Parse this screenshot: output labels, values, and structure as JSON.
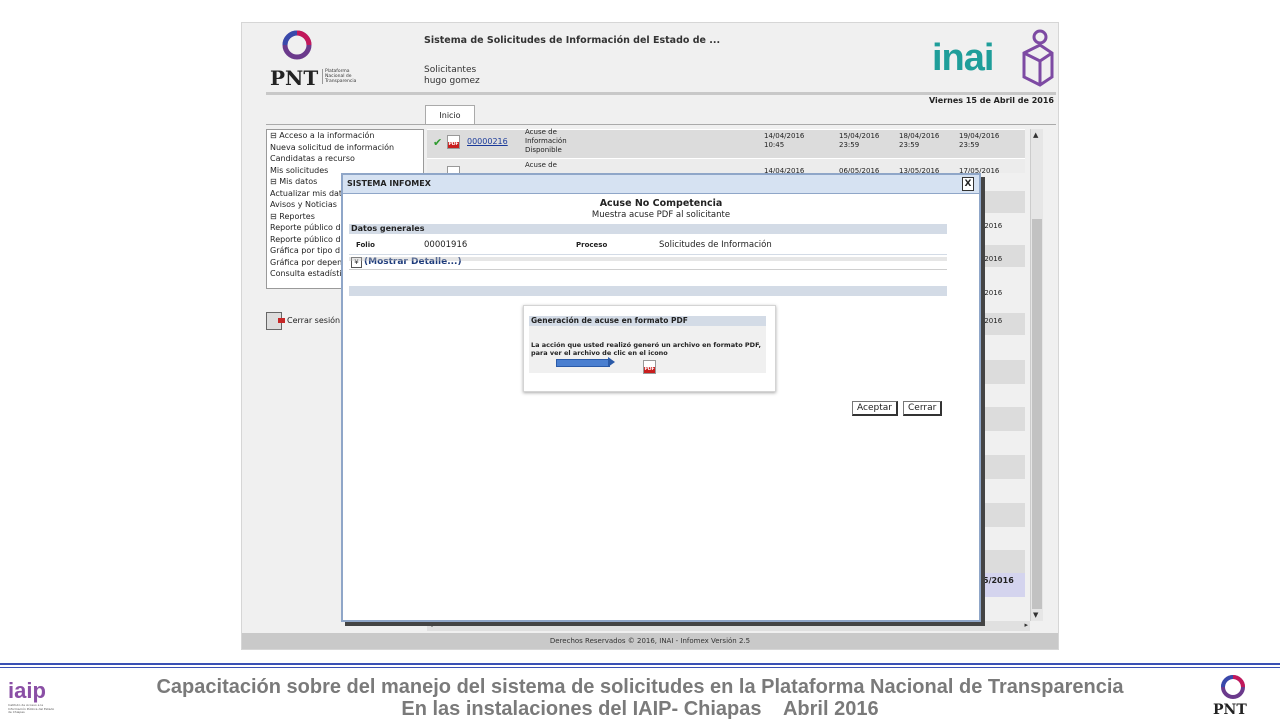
{
  "app": {
    "title": "Sistema de Solicitudes de Información del Estado de ...",
    "user_role": "Solicitantes",
    "user_name": "hugo gomez",
    "date": "Viernes 15 de Abril de 2016",
    "tab": "Inicio",
    "pnt_logo": {
      "word": "PNT",
      "sub": "Plataforma Nacional de Transparencia"
    },
    "inai_logo": "inai"
  },
  "sidebar": {
    "items": [
      "⊟ Acceso a la información",
      "Nueva solicitud de información",
      "Candidatas a recurso",
      "Mis solicitudes",
      "⊟ Mis datos",
      "Actualizar mis datos",
      "Avisos y Noticias",
      "⊟ Reportes",
      "Reporte público de",
      "Reporte público de",
      "Gráfica por tipo d",
      "Gráfica por depen",
      "Consulta estadísti"
    ],
    "logout": "Cerrar sesión"
  },
  "table": {
    "rows": [
      {
        "folio": "00000216",
        "desc": [
          "Acuse de",
          "Información",
          "Disponible"
        ],
        "d1": "14/04/2016",
        "t1": "10:45",
        "d2": "15/04/2016",
        "t2": "23:59",
        "d3": "18/04/2016",
        "t3": "23:59",
        "d4": "19/04/2016",
        "t4": "23:59"
      },
      {
        "desc": [
          "Acuse de"
        ],
        "d1": "14/04/2016",
        "d2": "06/05/2016",
        "d3": "13/05/2016",
        "d4": "17/05/2016"
      }
    ],
    "right_dates": [
      "/2016",
      "/2016",
      "/2016",
      "/2016"
    ],
    "highlight_date": "5/2016"
  },
  "modal": {
    "title": "SISTEMA INFOMEX",
    "close": "X",
    "heading": "Acuse No Competencia",
    "subheading": "Muestra acuse PDF al solicitante",
    "section": "Datos generales",
    "folio_label": "Folio",
    "folio_value": "00001916",
    "proceso_label": "Proceso",
    "proceso_value": "Solicitudes de Información",
    "show_detail": "(Mostrar Detalle...)",
    "pdf_box_title": "Generación de acuse en formato PDF",
    "pdf_box_text": "La acción que usted realizó generó un archivo en formato PDF, para ver el archivo de clic en el icono",
    "accept": "Aceptar",
    "cancel": "Cerrar"
  },
  "status_bar": "Derechos Reservados © 2016, INAI - Infomex Versión 2.5",
  "caption": {
    "line1": "Capacitación sobre del manejo del sistema de solicitudes en la Plataforma Nacional de Transparencia",
    "line2": "En las instalaciones del IAIP- Chiapas    Abril 2016",
    "iaip_logo": "iaip",
    "iaip_sub": "Instituto de Acceso a la Información Pública del Estado de Chiapas",
    "pnt_word": "PNT"
  },
  "colors": {
    "modal_border": "#8fa6c8",
    "modal_title_bar": "#d6e2f2",
    "section_bar": "#d3dbe6",
    "pnt_purple": "#6b3a8c",
    "inai_teal": "#1f9e9a",
    "inai_purple": "#7d4aa3",
    "caption_text": "#7a7a7a",
    "footer_blue": "#3a50b4"
  }
}
